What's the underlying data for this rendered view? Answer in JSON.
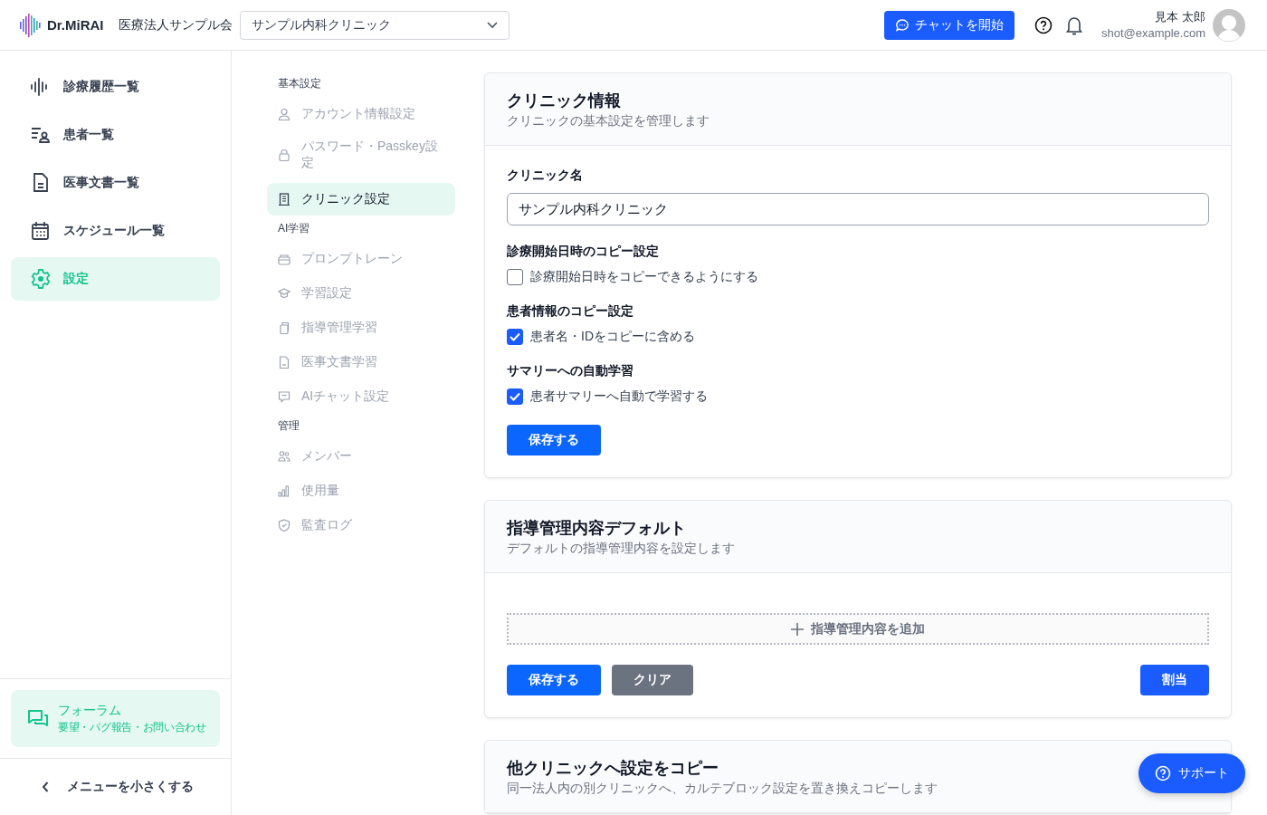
{
  "header": {
    "brand": "Dr.MiRAI",
    "org": "医療法人サンプル会",
    "clinic_select": "サンプル内科クリニック",
    "chat_button": "チャットを開始",
    "user_name": "見本 太郎",
    "user_email": "shot@example.com"
  },
  "sidebar": {
    "items": [
      {
        "label": "診療履歴一覧",
        "selected": false
      },
      {
        "label": "患者一覧",
        "selected": false
      },
      {
        "label": "医事文書一覧",
        "selected": false
      },
      {
        "label": "スケジュール一覧",
        "selected": false
      },
      {
        "label": "設定",
        "selected": true
      }
    ],
    "forum": {
      "title": "フォーラム",
      "subtitle": "要望・バグ報告・お問い合わせ"
    },
    "collapse": "メニューを小さくする"
  },
  "settings_nav": {
    "groups": [
      {
        "heading": "基本設定",
        "items": [
          {
            "label": "アカウント情報設定",
            "selected": false
          },
          {
            "label": "パスワード・Passkey設定",
            "selected": false
          },
          {
            "label": "クリニック設定",
            "selected": true
          }
        ]
      },
      {
        "heading": "AI学習",
        "items": [
          {
            "label": "プロンプトレーン",
            "selected": false
          },
          {
            "label": "学習設定",
            "selected": false
          },
          {
            "label": "指導管理学習",
            "selected": false
          },
          {
            "label": "医事文書学習",
            "selected": false
          },
          {
            "label": "AIチャット設定",
            "selected": false
          }
        ]
      },
      {
        "heading": "管理",
        "items": [
          {
            "label": "メンバー",
            "selected": false
          },
          {
            "label": "使用量",
            "selected": false
          },
          {
            "label": "監査ログ",
            "selected": false
          }
        ]
      }
    ]
  },
  "cards": [
    {
      "title": "クリニック情報",
      "subtitle": "クリニックの基本設定を管理します",
      "field_label": "クリニック名",
      "field_value": "サンプル内科クリニック",
      "sections": [
        {
          "heading": "診療開始日時のコピー設定",
          "option": "診療開始日時をコピーできるようにする",
          "checked": false
        },
        {
          "heading": "患者情報のコピー設定",
          "option": "患者名・IDをコピーに含める",
          "checked": true
        },
        {
          "heading": "サマリーへの自動学習",
          "option": "患者サマリーへ自動で学習する",
          "checked": true
        }
      ],
      "buttons": [
        {
          "label": "保存する",
          "kind": "primary"
        }
      ]
    },
    {
      "title": "指導管理内容デフォルト",
      "subtitle": "デフォルトの指導管理内容を設定します",
      "add_button": "指導管理内容を追加",
      "buttons": [
        {
          "label": "保存する",
          "kind": "primary"
        },
        {
          "label": "クリア",
          "kind": "secondary"
        },
        {
          "label": "割当",
          "kind": "assign"
        }
      ]
    },
    {
      "title": "他クリニックへ設定をコピー",
      "subtitle": "同一法人内の別クリニックへ、カルテブロック設定を置き換えコピーします"
    }
  ],
  "support_button": "サポート"
}
